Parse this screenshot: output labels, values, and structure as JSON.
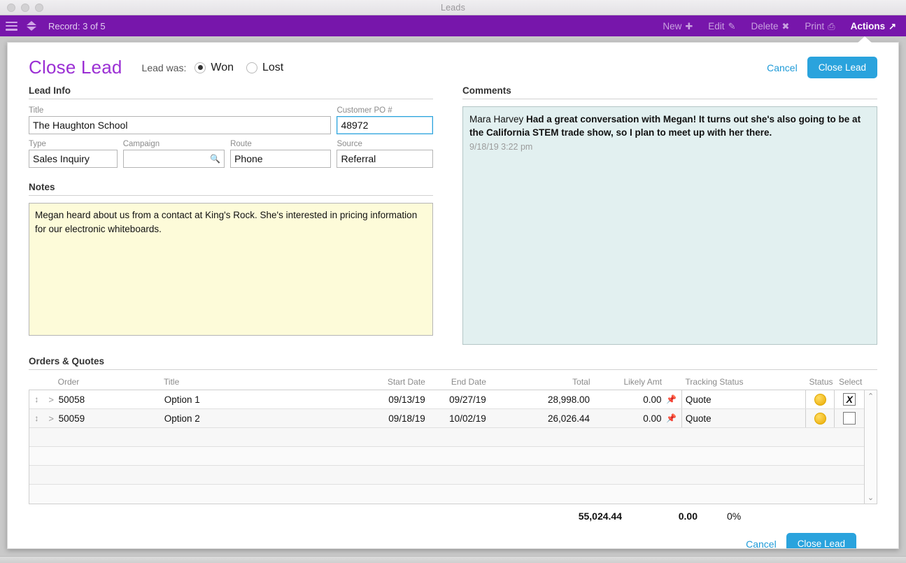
{
  "window": {
    "title": "Leads",
    "traffic_lights": [
      "close",
      "minimize",
      "zoom"
    ]
  },
  "toolbar": {
    "menu_icon": "hamburger-icon",
    "nav_icon": "up-down-arrows-icon",
    "record_label": "Record: 3 of 5",
    "items": [
      {
        "label": "New",
        "icon": "plus-icon",
        "glyph": "✚",
        "active": false
      },
      {
        "label": "Edit",
        "icon": "pencil-icon",
        "glyph": "✎",
        "active": false
      },
      {
        "label": "Delete",
        "icon": "x-cross-icon",
        "glyph": "✖",
        "active": false
      },
      {
        "label": "Print",
        "icon": "printer-icon",
        "glyph": "⎙",
        "active": false
      },
      {
        "label": "Actions",
        "icon": "arrow-up-right-icon",
        "glyph": "↗",
        "active": true
      }
    ]
  },
  "dialog": {
    "title": "Close Lead",
    "lead_was_label": "Lead was:",
    "radios": [
      {
        "label": "Won",
        "selected": true
      },
      {
        "label": "Lost",
        "selected": false
      }
    ],
    "cancel_label": "Cancel",
    "primary_label": "Close Lead",
    "footer_cancel_label": "Cancel",
    "footer_primary_label": "Close Lead"
  },
  "lead_info": {
    "section_label": "Lead Info",
    "fields": [
      {
        "label": "Title",
        "value": "The Haughton School",
        "focused": false,
        "icon": null
      },
      {
        "label": "Customer PO #",
        "value": "48972",
        "focused": true,
        "icon": null
      },
      {
        "label": "Type",
        "value": "Sales Inquiry",
        "focused": false,
        "icon": null
      },
      {
        "label": "Campaign",
        "value": "",
        "focused": false,
        "icon": "search-icon"
      },
      {
        "label": "Route",
        "value": "Phone",
        "focused": false,
        "icon": null
      },
      {
        "label": "Source",
        "value": "Referral",
        "focused": false,
        "icon": null
      }
    ]
  },
  "notes": {
    "section_label": "Notes",
    "text": "Megan heard about us from a contact at King's Rock. She's interested in pricing information for our electronic whiteboards."
  },
  "comments": {
    "section_label": "Comments",
    "author": "Mara Harvey",
    "body": "Had a great conversation with Megan! It turns out she's also going to be at the California STEM trade show, so I plan to meet up with her there.",
    "timestamp": "9/18/19  3:22 pm"
  },
  "orders": {
    "section_label": "Orders & Quotes",
    "columns": [
      "Order",
      "Title",
      "Start Date",
      "End Date",
      "Total",
      "Likely Amt",
      "Tracking Status",
      "Status",
      "Select"
    ],
    "rows": [
      {
        "order": "50058",
        "title": "Option 1",
        "start_date": "09/13/19",
        "end_date": "09/27/19",
        "total": "28,998.00",
        "likely_amt": "0.00",
        "pin_icon": "pin-icon",
        "tracking_status": "Quote",
        "status_color": "#f0b81d",
        "selected": true,
        "select_glyph": "X"
      },
      {
        "order": "50059",
        "title": "Option 2",
        "start_date": "09/18/19",
        "end_date": "10/02/19",
        "total": "26,026.44",
        "likely_amt": "0.00",
        "pin_icon": "pin-icon",
        "tracking_status": "Quote",
        "status_color": "#f0b81d",
        "selected": false,
        "select_glyph": ""
      }
    ],
    "empty_row_count": 4,
    "totals": {
      "total": "55,024.44",
      "likely_amt": "0.00",
      "percent": "0%"
    },
    "scroll_up_glyph": "⌃",
    "scroll_down_glyph": "⌄"
  },
  "colors": {
    "toolbar_purple": "#7716ab",
    "title_purple": "#9b2fd4",
    "accent_blue": "#2aa3dd",
    "notes_yellow": "#fdfbd9",
    "comments_teal": "#e2f0f0",
    "status_gold": "#f0b81d"
  }
}
